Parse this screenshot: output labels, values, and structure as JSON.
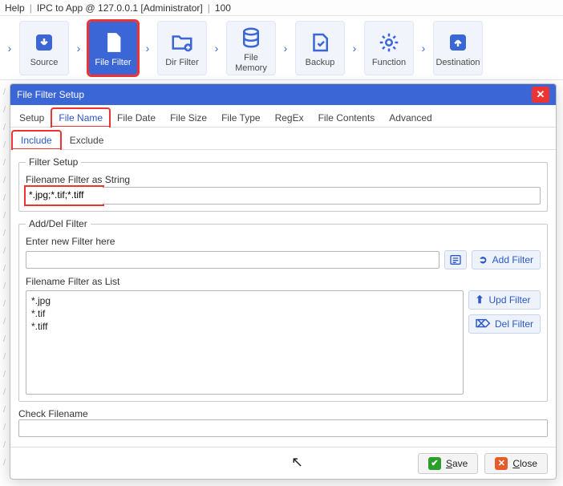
{
  "menu": {
    "help": "Help",
    "context": "IPC to App @ 127.0.0.1 [Administrator]",
    "count": "100"
  },
  "toolbar": {
    "items": [
      {
        "key": "source",
        "label": "Source"
      },
      {
        "key": "file-filter",
        "label": "File Filter",
        "active": true
      },
      {
        "key": "dir-filter",
        "label": "Dir Filter"
      },
      {
        "key": "file-memory",
        "label": "File Memory"
      },
      {
        "key": "backup",
        "label": "Backup"
      },
      {
        "key": "function",
        "label": "Function"
      },
      {
        "key": "destination",
        "label": "Destination"
      }
    ]
  },
  "dialog": {
    "title": "File Filter Setup",
    "tabs": [
      "Setup",
      "File Name",
      "File Date",
      "File Size",
      "File Type",
      "RegEx",
      "File Contents",
      "Advanced"
    ],
    "activeTab": "File Name",
    "subtabs": [
      "Include",
      "Exclude"
    ],
    "activeSubtab": "Include",
    "fs": {
      "legend": "Filter Setup",
      "string_label": "Filename Filter as String",
      "string_value": "*.jpg;*.tif;*.tiff"
    },
    "addDel": {
      "legend": "Add/Del Filter",
      "new_label": "Enter new Filter here",
      "new_value": "",
      "add_label": "Add Filter",
      "list_label": "Filename Filter as List",
      "list": [
        "*.jpg",
        "*.tif",
        "*.tiff"
      ],
      "upd_label": "Upd Filter",
      "del_label": "Del Filter"
    },
    "check": {
      "label": "Check Filename",
      "value": ""
    },
    "footer": {
      "save": "Save",
      "close": "Close"
    }
  }
}
